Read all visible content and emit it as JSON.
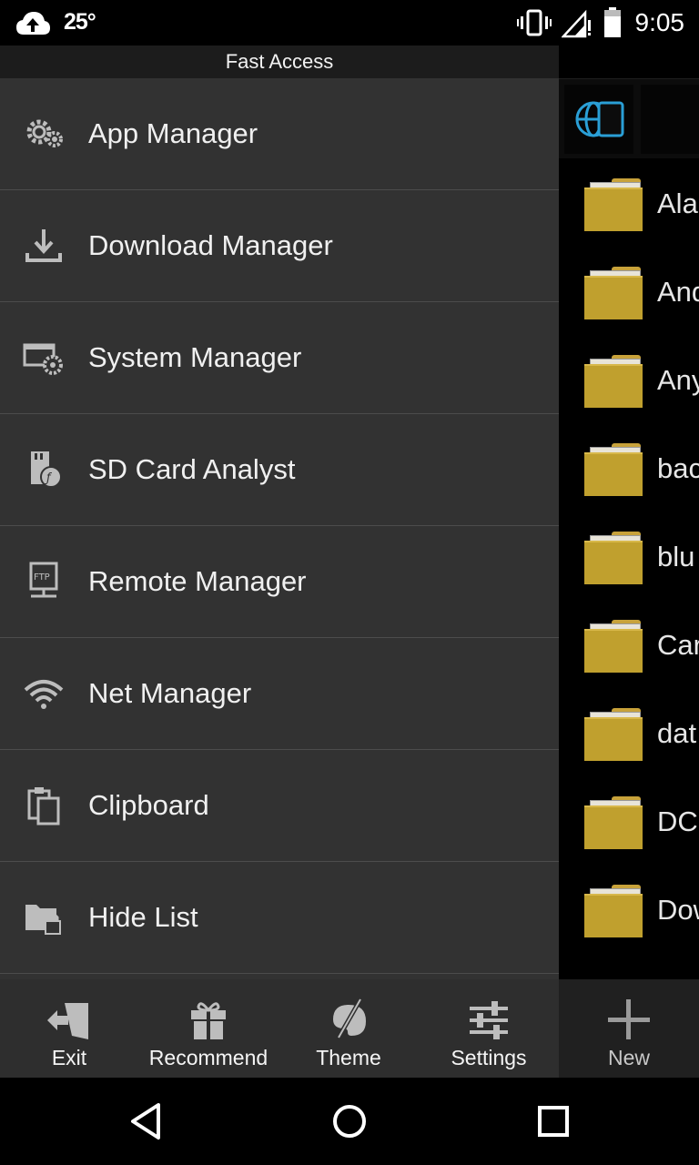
{
  "status_bar": {
    "temperature": "25°",
    "time": "9:05",
    "icons": [
      "cloud-upload-icon",
      "vibrate-icon",
      "signal-icon",
      "battery-icon"
    ]
  },
  "drawer": {
    "title": "Fast Access",
    "items": [
      {
        "label": "App Manager",
        "icon": "app-manager-gear-icon"
      },
      {
        "label": "Download Manager",
        "icon": "download-icon"
      },
      {
        "label": "System Manager",
        "icon": "system-manager-icon"
      },
      {
        "label": "SD Card Analyst",
        "icon": "sd-card-icon"
      },
      {
        "label": "Remote Manager",
        "icon": "ftp-icon"
      },
      {
        "label": "Net Manager",
        "icon": "wifi-icon"
      },
      {
        "label": "Clipboard",
        "icon": "clipboard-icon"
      },
      {
        "label": "Hide List",
        "icon": "hidden-folder-lock-icon"
      }
    ]
  },
  "file_list": {
    "items": [
      "Ala",
      "And",
      "Any",
      "bac",
      "blu",
      "Car",
      "dat",
      "DCI",
      "Dow"
    ]
  },
  "toolbar": {
    "exit_label": "Exit",
    "recommend_label": "Recommend",
    "theme_label": "Theme",
    "settings_label": "Settings",
    "new_label": "New"
  },
  "navbar": {
    "icons": [
      "back-icon",
      "home-icon",
      "recents-icon"
    ]
  },
  "colors": {
    "drawer_bg": "#323232",
    "folder": "#c0a02e",
    "accent_blue": "#2a9fd6"
  }
}
